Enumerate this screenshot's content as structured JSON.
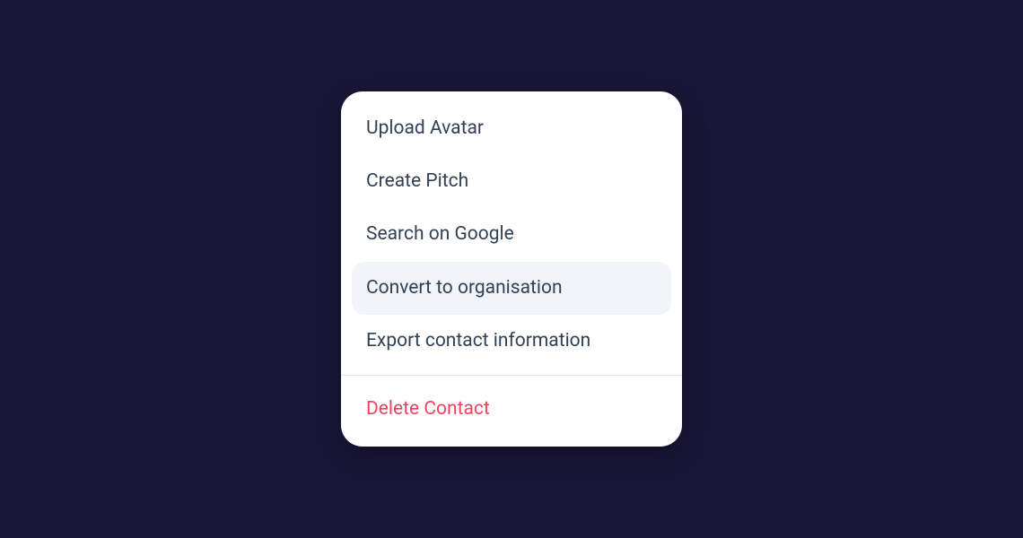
{
  "menu": {
    "items": [
      {
        "label": "Upload Avatar",
        "hovered": false
      },
      {
        "label": "Create Pitch",
        "hovered": false
      },
      {
        "label": "Search on Google",
        "hovered": false
      },
      {
        "label": "Convert to organisation",
        "hovered": true
      },
      {
        "label": "Export contact information",
        "hovered": false
      }
    ],
    "danger_item": {
      "label": "Delete Contact"
    }
  }
}
